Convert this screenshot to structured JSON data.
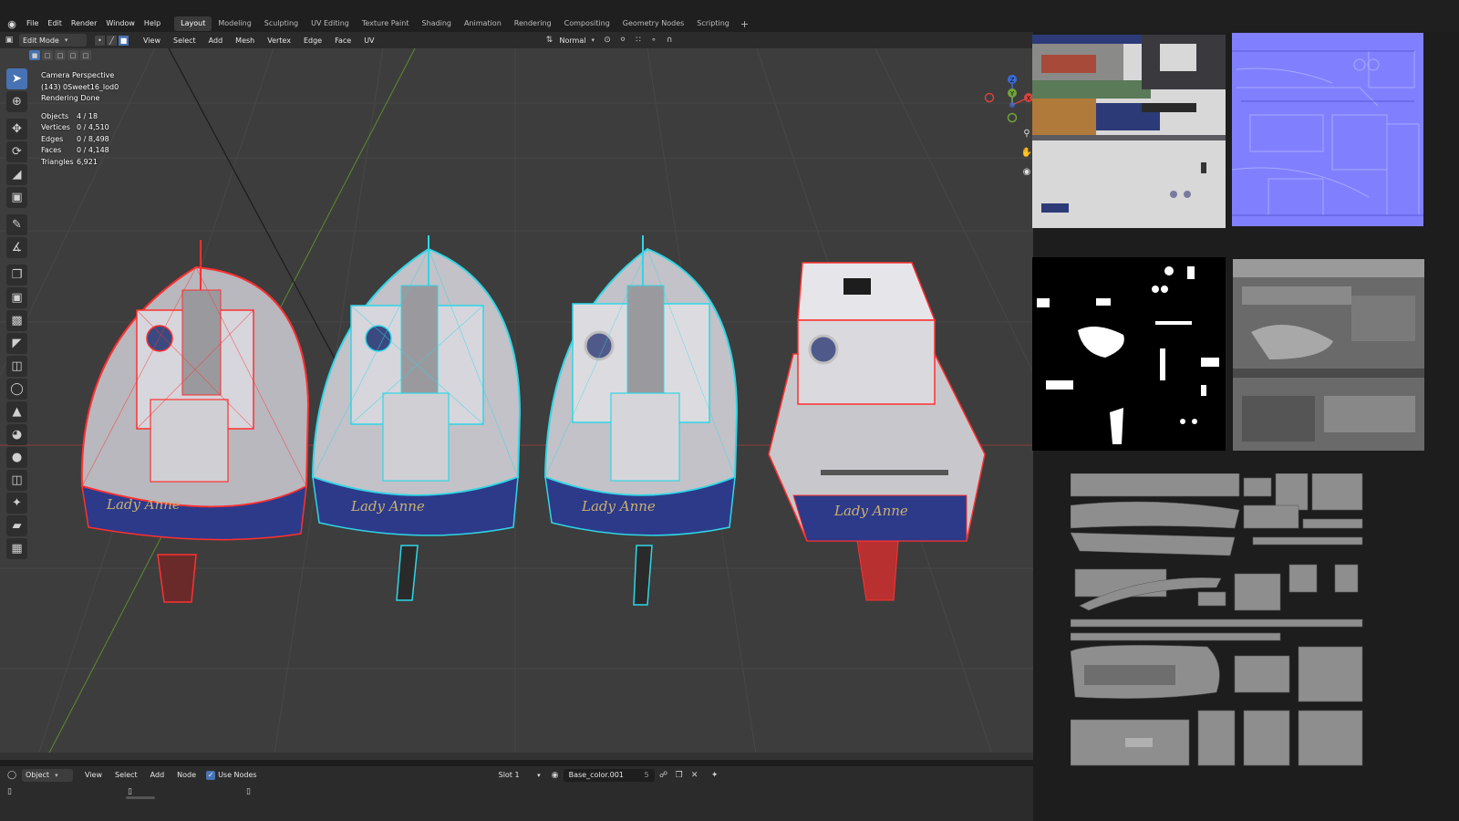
{
  "menus": [
    "File",
    "Edit",
    "Render",
    "Window",
    "Help"
  ],
  "workspaces": [
    {
      "label": "Layout",
      "active": true
    },
    {
      "label": "Modeling"
    },
    {
      "label": "Sculpting"
    },
    {
      "label": "UV Editing"
    },
    {
      "label": "Texture Paint"
    },
    {
      "label": "Shading"
    },
    {
      "label": "Animation"
    },
    {
      "label": "Rendering"
    },
    {
      "label": "Compositing"
    },
    {
      "label": "Geometry Nodes"
    },
    {
      "label": "Scripting"
    }
  ],
  "workspace_add": "+",
  "viewport_header": {
    "mode": "Edit Mode",
    "menus": [
      "View",
      "Select",
      "Add",
      "Mesh",
      "Vertex",
      "Edge",
      "Face",
      "UV"
    ],
    "orientation": "Normal"
  },
  "overlay": {
    "view": "Camera Perspective",
    "object": "(143) 0Sweet16_lod0",
    "status": "Rendering Done",
    "stats": [
      {
        "k": "Objects",
        "v": "4 / 18"
      },
      {
        "k": "Vertices",
        "v": "0 / 4,510"
      },
      {
        "k": "Edges",
        "v": "0 / 8,498"
      },
      {
        "k": "Faces",
        "v": "0 / 4,148"
      },
      {
        "k": "Triangles",
        "v": "6,921"
      }
    ]
  },
  "boat_name": "Lady Anne",
  "gizmo": {
    "z": "Z",
    "y": "Y",
    "x": "X"
  },
  "node_header": {
    "mode": "Object",
    "menus": [
      "View",
      "Select",
      "Add",
      "Node"
    ],
    "use_nodes": "Use Nodes",
    "slot": "Slot 1",
    "material": "Base_color.001",
    "users": "5"
  },
  "colors": {
    "accent": "#4772b3",
    "select_red": "#ff3030",
    "select_cyan": "#2fd6e6",
    "hull_blue": "#2d3a8a"
  }
}
